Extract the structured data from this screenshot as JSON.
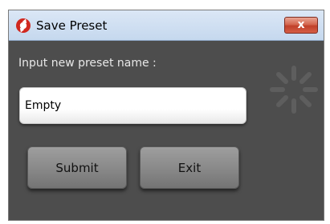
{
  "window": {
    "title": "Save Preset",
    "close_glyph": "x",
    "app_icon": "red-cog-icon"
  },
  "form": {
    "prompt_label": "Input new preset name :",
    "preset_name_value": "Empty"
  },
  "buttons": {
    "submit_label": "Submit",
    "exit_label": "Exit"
  },
  "indicator": {
    "icon": "loading-spinner-icon"
  },
  "colors": {
    "dialog_background": "#4d4d4d",
    "titlebar": "#c5d8ee",
    "close_button": "#c94e36",
    "app_icon": "#d0281f",
    "button_face": "#8a8a8a"
  }
}
